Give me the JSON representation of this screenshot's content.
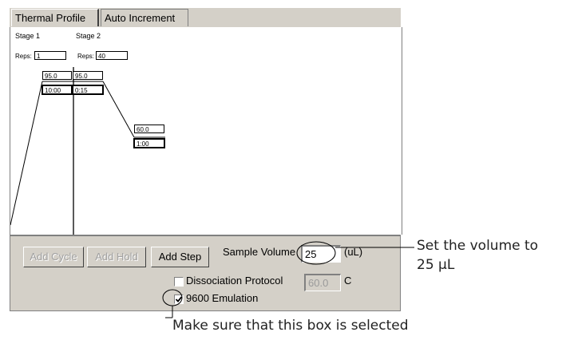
{
  "tabs": [
    {
      "label": "Thermal Profile"
    },
    {
      "label": "Auto Increment"
    }
  ],
  "profile": {
    "stage1": {
      "title": "Stage 1",
      "reps_label": "Reps:",
      "reps": "1"
    },
    "stage2": {
      "title": "Stage 2",
      "reps_label": "Reps:",
      "reps": "40"
    },
    "steps": [
      {
        "temp": "95.0",
        "time": "10:00"
      },
      {
        "temp": "95.0",
        "time": "0:15"
      },
      {
        "temp": "60.0",
        "time": "1:00"
      }
    ]
  },
  "panel": {
    "add_cycle": "Add Cycle",
    "add_hold": "Add Hold",
    "add_step": "Add Step",
    "sample_volume_label": "Sample Volume",
    "sample_volume": "25",
    "volume_unit": "(uL)",
    "dissociation_label": "Dissociation Protocol",
    "dissociation_checked": false,
    "dissociation_temp": "60.0",
    "temp_unit": "C",
    "emulation_label": "9600 Emulation",
    "emulation_checked": true
  },
  "callouts": {
    "volume_line1": "Set the volume to",
    "volume_line2": "25 μL",
    "checkbox": "Make sure that this box is selected"
  }
}
